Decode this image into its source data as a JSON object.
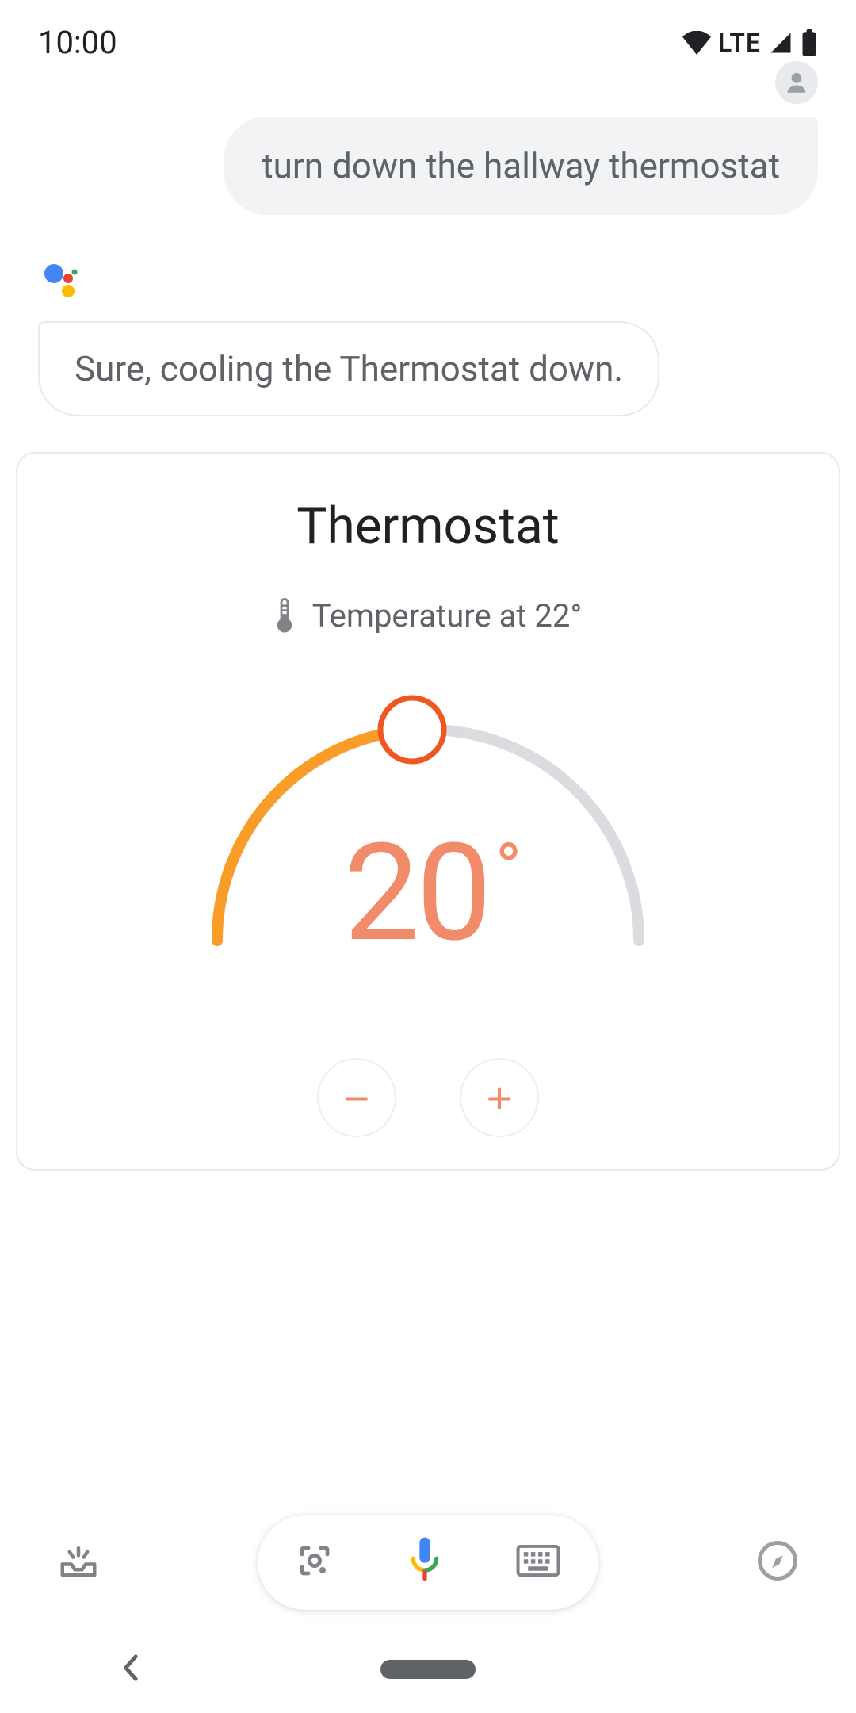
{
  "status": {
    "time": "10:00",
    "network": "LTE"
  },
  "chat": {
    "user_msg": "turn down the hallway thermostat",
    "assistant_msg": "Sure, cooling the Thermostat down."
  },
  "card": {
    "title": "Thermostat",
    "current_label": "Temperature at 22°",
    "target_temp": "20",
    "degree": "°",
    "minus": "−",
    "plus": "+"
  }
}
